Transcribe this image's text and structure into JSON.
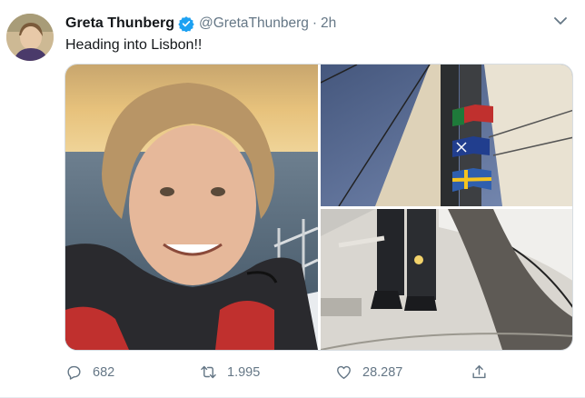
{
  "tweet": {
    "author_name": "Greta Thunberg",
    "handle": "@GretaThunberg",
    "separator": "·",
    "time": "2h",
    "text": "Heading into Lisbon!!",
    "verified": true,
    "media": [
      {
        "name": "photo-portrait",
        "icon": "photo"
      },
      {
        "name": "photo-sail-flags",
        "icon": "photo"
      },
      {
        "name": "photo-deck",
        "icon": "photo"
      }
    ],
    "actions": {
      "reply_count": "682",
      "retweet_count": "1.995",
      "like_count": "28.287"
    }
  },
  "colors": {
    "verified": "#1da1f2",
    "meta_text": "#657786",
    "text": "#14171a"
  }
}
